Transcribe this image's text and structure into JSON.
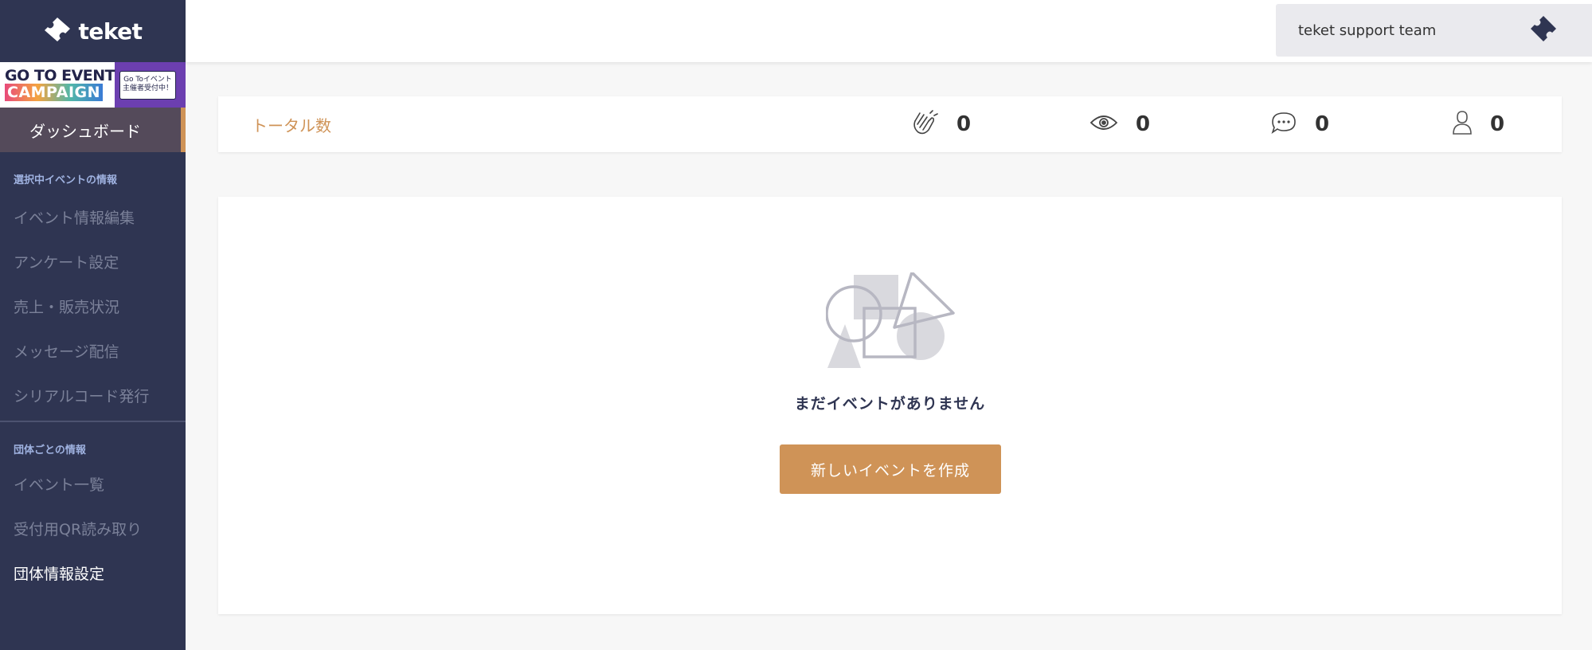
{
  "app": {
    "logo_text": "teket"
  },
  "banner": {
    "line1": "GO TO EVENT",
    "line2": "CAMPAIGN",
    "badge_line1": "Go Toイベント",
    "badge_line2": "主催者受付中！"
  },
  "sidebar": {
    "active_item": "ダッシュボード",
    "section1_heading": "選択中イベントの情報",
    "section1_items": [
      {
        "label": "イベント情報編集"
      },
      {
        "label": "アンケート設定"
      },
      {
        "label": "売上・販売状況"
      },
      {
        "label": "メッセージ配信"
      },
      {
        "label": "シリアルコード発行"
      }
    ],
    "section2_heading": "団体ごとの情報",
    "section2_items": [
      {
        "label": "イベント一覧"
      },
      {
        "label": "受付用QR読み取り"
      },
      {
        "label": "団体情報設定"
      }
    ]
  },
  "header": {
    "team_name": "teket support team"
  },
  "totals": {
    "label": "トータル数",
    "claps": "0",
    "views": "0",
    "comments": "0",
    "users": "0"
  },
  "empty_state": {
    "message": "まだイベントがありません",
    "create_button": "新しいイベントを作成"
  },
  "colors": {
    "sidebar_bg": "#2f3552",
    "accent": "#cf9357",
    "active_item_bg": "#544a5a"
  }
}
